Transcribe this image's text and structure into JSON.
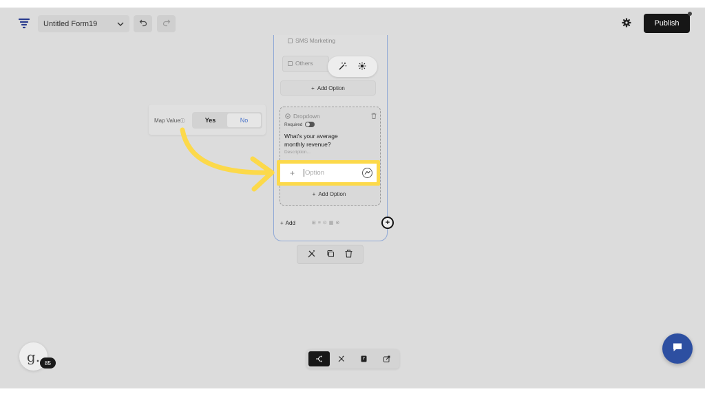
{
  "header": {
    "form_name": "Untitled Form19",
    "publish_label": "Publish"
  },
  "form": {
    "sms_option": "SMS Marketing",
    "others_option": "Others",
    "add_option_label": "Add Option",
    "dropdown_field": {
      "type_label": "Dropdown",
      "required_label": "Required",
      "question_line1": "What's your average",
      "question_line2": "monthly revenue?",
      "description_placeholder": "Description...",
      "option_placeholder": "Option",
      "add_option_label": "Add Option"
    },
    "add_label": "Add"
  },
  "map_value": {
    "label": "Map Value",
    "yes": "Yes",
    "no": "No"
  },
  "avatar": {
    "letter": "g.",
    "count": "85"
  },
  "colors": {
    "highlight": "#fcd94a",
    "arrow": "#fcd94a",
    "publish_bg": "#161616",
    "chat_bg": "#2d4fa1",
    "no_text": "#4b74c9"
  }
}
